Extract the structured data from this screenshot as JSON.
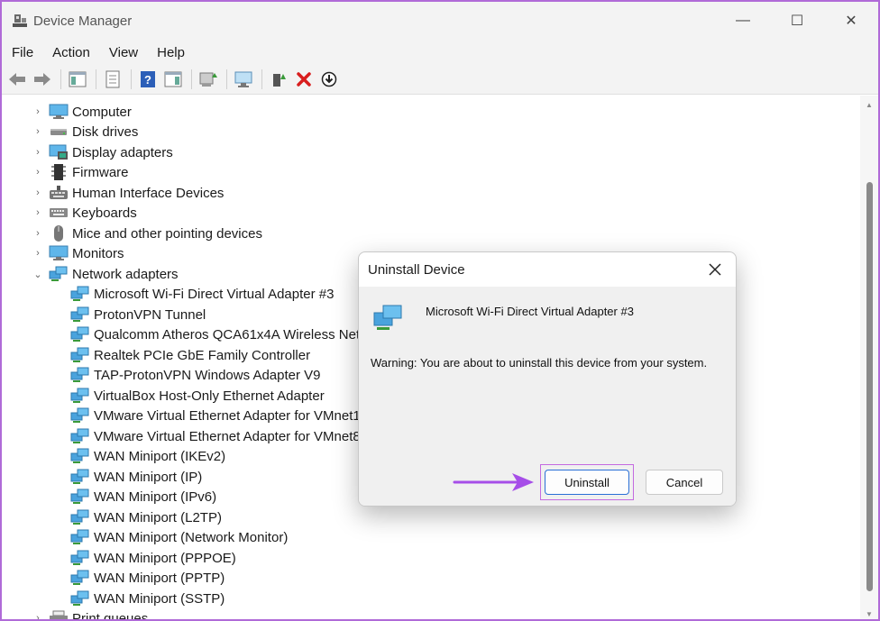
{
  "window": {
    "title": "Device Manager",
    "controls": {
      "minimize": "—",
      "maximize": "☐",
      "close": "✕"
    }
  },
  "menu": [
    "File",
    "Action",
    "View",
    "Help"
  ],
  "tree": {
    "categories": [
      {
        "label": "Computer",
        "icon": "computer-icon",
        "expanded": false
      },
      {
        "label": "Disk drives",
        "icon": "disk-drive-icon",
        "expanded": false
      },
      {
        "label": "Display adapters",
        "icon": "display-adapter-icon",
        "expanded": false
      },
      {
        "label": "Firmware",
        "icon": "firmware-icon",
        "expanded": false
      },
      {
        "label": "Human Interface Devices",
        "icon": "hid-icon",
        "expanded": false
      },
      {
        "label": "Keyboards",
        "icon": "keyboard-icon",
        "expanded": false
      },
      {
        "label": "Mice and other pointing devices",
        "icon": "mouse-icon",
        "expanded": false
      },
      {
        "label": "Monitors",
        "icon": "monitor-icon",
        "expanded": false
      },
      {
        "label": "Network adapters",
        "icon": "network-adapter-icon",
        "expanded": true
      }
    ],
    "network_adapters": [
      "Microsoft Wi-Fi Direct Virtual Adapter #3",
      "ProtonVPN Tunnel",
      "Qualcomm Atheros QCA61x4A Wireless Netwo",
      "Realtek PCIe GbE Family Controller",
      "TAP-ProtonVPN Windows Adapter V9",
      "VirtualBox Host-Only Ethernet Adapter",
      "VMware Virtual Ethernet Adapter for VMnet1",
      "VMware Virtual Ethernet Adapter for VMnet8",
      "WAN Miniport (IKEv2)",
      "WAN Miniport (IP)",
      "WAN Miniport (IPv6)",
      "WAN Miniport (L2TP)",
      "WAN Miniport (Network Monitor)",
      "WAN Miniport (PPPOE)",
      "WAN Miniport (PPTP)",
      "WAN Miniport (SSTP)"
    ],
    "partial_next": "Print queues"
  },
  "dialog": {
    "title": "Uninstall Device",
    "device_name": "Microsoft Wi-Fi Direct Virtual Adapter #3",
    "warning": "Warning: You are about to uninstall this device from your system.",
    "uninstall_label": "Uninstall",
    "cancel_label": "Cancel"
  },
  "colors": {
    "accent": "#2a6fd6",
    "highlight": "#c46ae0",
    "arrow": "#a64ee8"
  }
}
